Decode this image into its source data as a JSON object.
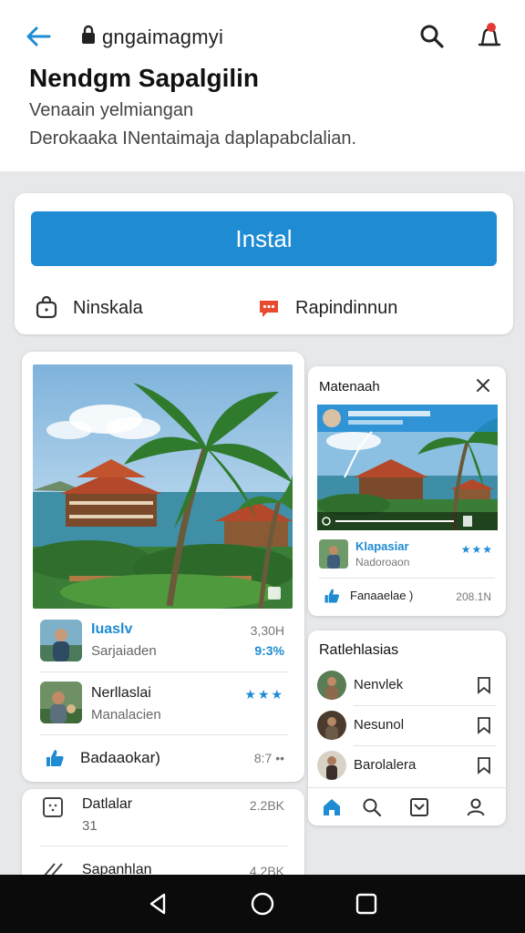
{
  "browser": {
    "url": "gngaimagmyi"
  },
  "page": {
    "title": "Nendgm Sapalgilin",
    "subtitle_line1": "Venaain yelmiangan",
    "subtitle_line2": "Derokaaka INentaimaja daplapabclalian."
  },
  "install_card": {
    "button_label": "Instal",
    "action1_label": "Ninskala",
    "action2_label": "Rapindinnun"
  },
  "left_card": {
    "rows": [
      {
        "title": "Iuaslv",
        "subtitle": "Sarjaiaden",
        "meta_top": "3,30H",
        "meta_bottom": "9:3%"
      },
      {
        "title": "Nerllaslai",
        "subtitle": "Manalacien",
        "meta_top": "★★★"
      }
    ],
    "footer_label": "Badaaokar)",
    "footer_meta": "8:7 ••"
  },
  "left_card2": {
    "row1_title": "Datlalar",
    "row1_sub": "31",
    "row1_meta": "2.2BK",
    "row2_title": "Sapanhlan",
    "row2_meta": "4.2BK"
  },
  "right_card": {
    "title": "Matenaah",
    "row_title": "Klapasiar",
    "row_subtitle": "Nadoroaon",
    "row_meta": "★★★",
    "footer_label": "Fanaaelae )",
    "footer_meta": "208.1N"
  },
  "right_card2": {
    "title": "Ratlehlasias",
    "items": [
      {
        "label": "Nenvlek"
      },
      {
        "label": "Nesunol"
      },
      {
        "label": "Barolalera"
      }
    ]
  },
  "colors": {
    "accent": "#1e8bd3",
    "alert": "#e53935",
    "chat_icon": "#e84a2f"
  }
}
